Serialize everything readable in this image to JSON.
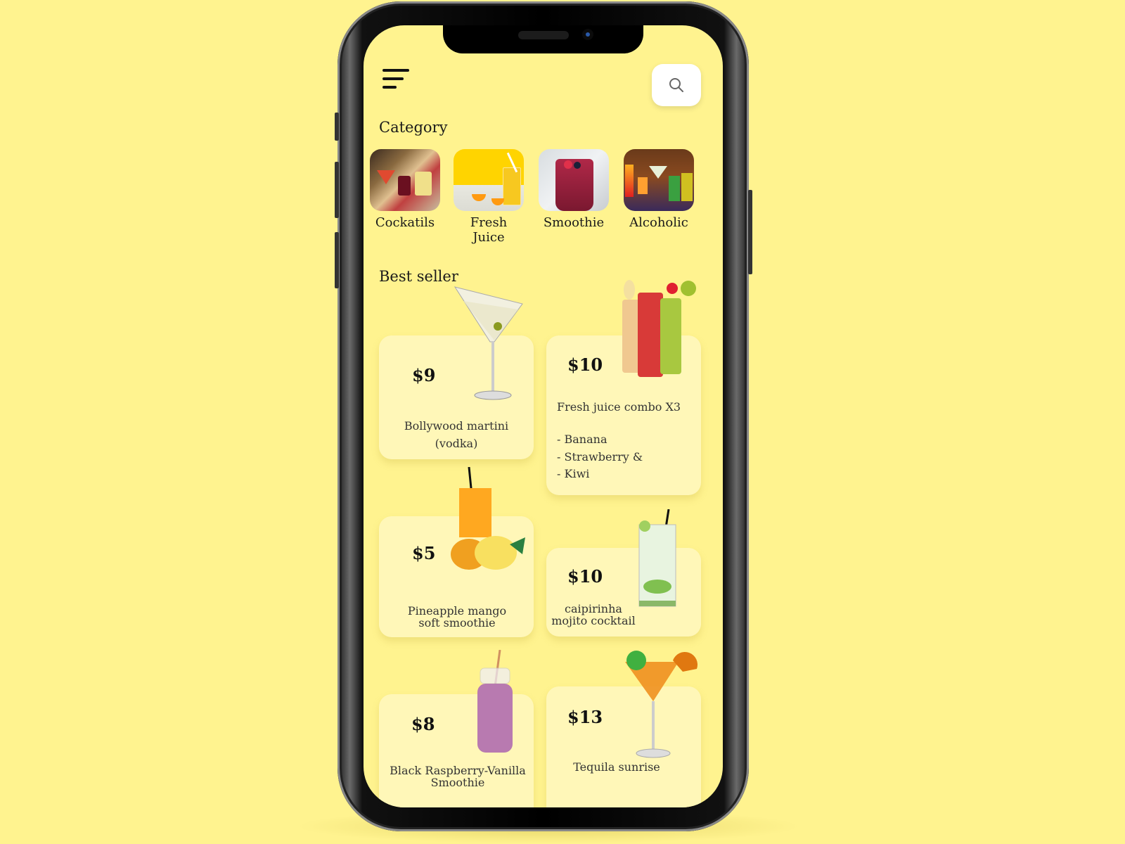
{
  "header": {
    "menu_icon": "hamburger-menu-icon",
    "search_icon": "search-icon"
  },
  "category": {
    "title": "Category",
    "items": [
      {
        "label": "Cockatils",
        "image": "cocktails-photo"
      },
      {
        "label": "Fresh Juice",
        "image": "fresh-juice-photo"
      },
      {
        "label": "Smoothie",
        "image": "smoothie-photo"
      },
      {
        "label": "Alcoholic",
        "image": "alcoholic-photo"
      }
    ]
  },
  "best_seller": {
    "title": "Best seller",
    "products": [
      {
        "price": "$9",
        "name": "Bollywood martini (vodka)",
        "image": "martini-glass"
      },
      {
        "price": "$10",
        "name": "Fresh juice combo X3",
        "details": [
          "- Banana",
          "- Strawberry &",
          "- Kiwi"
        ],
        "image": "three-juice-glasses"
      },
      {
        "price": "$5",
        "name": "Pineapple mango soft smoothie",
        "image": "mango-pineapple-juice"
      },
      {
        "price": "$10",
        "name": "caipirinha mojito cocktail",
        "image": "mojito-glass"
      },
      {
        "price": "$8",
        "name": "Black Raspberry-Vanilla Smoothie",
        "image": "smoothie-bottle"
      },
      {
        "price": "$13",
        "name": "Tequila sunrise",
        "image": "tequila-sunrise-glass"
      }
    ]
  },
  "colors": {
    "background": "#fff38f",
    "card": "#fff7b8",
    "search_button": "#ffffff",
    "text": "#1a1a1a"
  }
}
